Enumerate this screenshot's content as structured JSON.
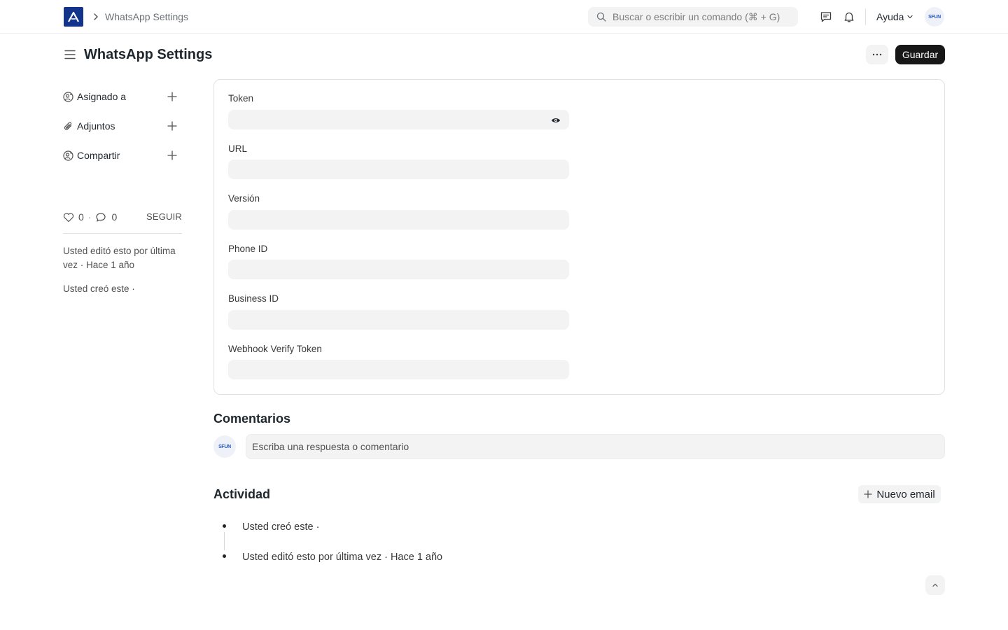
{
  "navbar": {
    "breadcrumb": "WhatsApp Settings",
    "search_placeholder": "Buscar o escribir un comando (⌘ + G)",
    "help_label": "Ayuda",
    "avatar_text": "SFUN"
  },
  "page": {
    "title": "WhatsApp Settings",
    "save_label": "Guardar",
    "more_label": "···"
  },
  "sidebar": {
    "assigned_label": "Asignado a",
    "attachments_label": "Adjuntos",
    "share_label": "Compartir",
    "likes_count": "0",
    "comments_count": "0",
    "follow_label": "SEGUIR",
    "last_edited": "Usted editó esto por última vez · Hace 1 año",
    "created": "Usted creó este ·"
  },
  "form": {
    "fields": [
      {
        "label": "Token",
        "value": ""
      },
      {
        "label": "URL",
        "value": ""
      },
      {
        "label": "Versión",
        "value": ""
      },
      {
        "label": "Phone ID",
        "value": ""
      },
      {
        "label": "Business ID",
        "value": ""
      },
      {
        "label": "Webhook Verify Token",
        "value": ""
      }
    ]
  },
  "comments": {
    "title": "Comentarios",
    "placeholder": "Escriba una respuesta o comentario",
    "avatar_text": "SFUN"
  },
  "activity": {
    "title": "Actividad",
    "new_email_label": "Nuevo email",
    "items": [
      {
        "text": "Usted creó este ·"
      },
      {
        "text": "Usted editó esto por última vez · Hace 1 año"
      }
    ]
  },
  "colors": {
    "brand": "#12358b",
    "primary_button": "#171717",
    "input_bg": "#f3f3f3"
  }
}
